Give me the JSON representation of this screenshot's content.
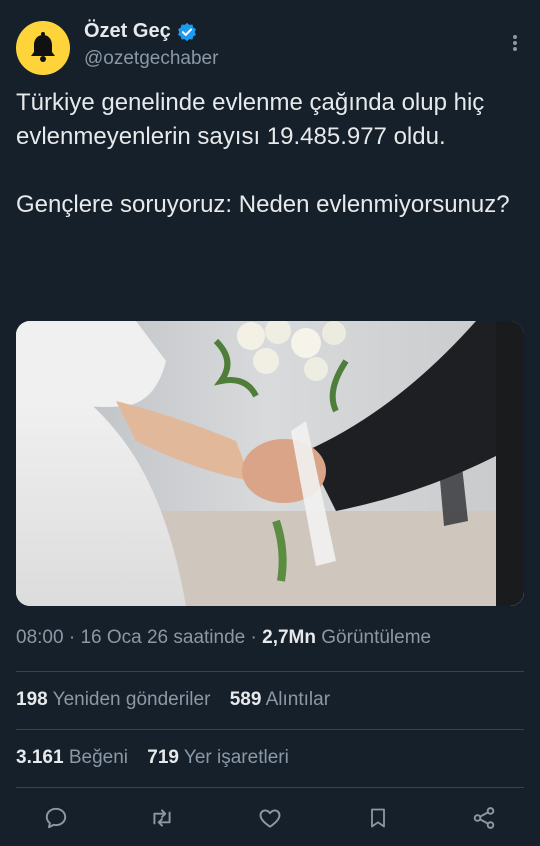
{
  "author": {
    "name": "Özet Geç",
    "handle": "@ozetgechaber",
    "verified": true,
    "avatar_icon": "bell-icon",
    "avatar_color": "#ffd43b"
  },
  "tweet": {
    "paragraph_1": "Türkiye genelinde evlenme çağında olup hiç evlenmeyenlerin sayısı 19.485.977 oldu.",
    "paragraph_2": "Gençlere soruyoruz: Neden evlenmiyorsunuz?"
  },
  "meta": {
    "time": "08:00",
    "separator": " · ",
    "date": "16 Oca 26 saatinde",
    "views_count": "2,7Mn",
    "views_label": "Görüntüleme"
  },
  "stats": {
    "reposts_count": "198",
    "reposts_label": "Yeniden gönderiler",
    "quotes_count": "589",
    "quotes_label": "Alıntılar",
    "likes_count": "3.161",
    "likes_label": "Beğeni",
    "bookmarks_count": "719",
    "bookmarks_label": "Yer işaretleri"
  },
  "actions": [
    "reply-icon",
    "retweet-icon",
    "like-icon",
    "bookmark-icon",
    "share-icon"
  ],
  "colors": {
    "background": "#15202b",
    "text": "#e7e9ea",
    "secondary": "#8b98a5",
    "verified": "#1d9bf0",
    "divider": "#38444d"
  }
}
